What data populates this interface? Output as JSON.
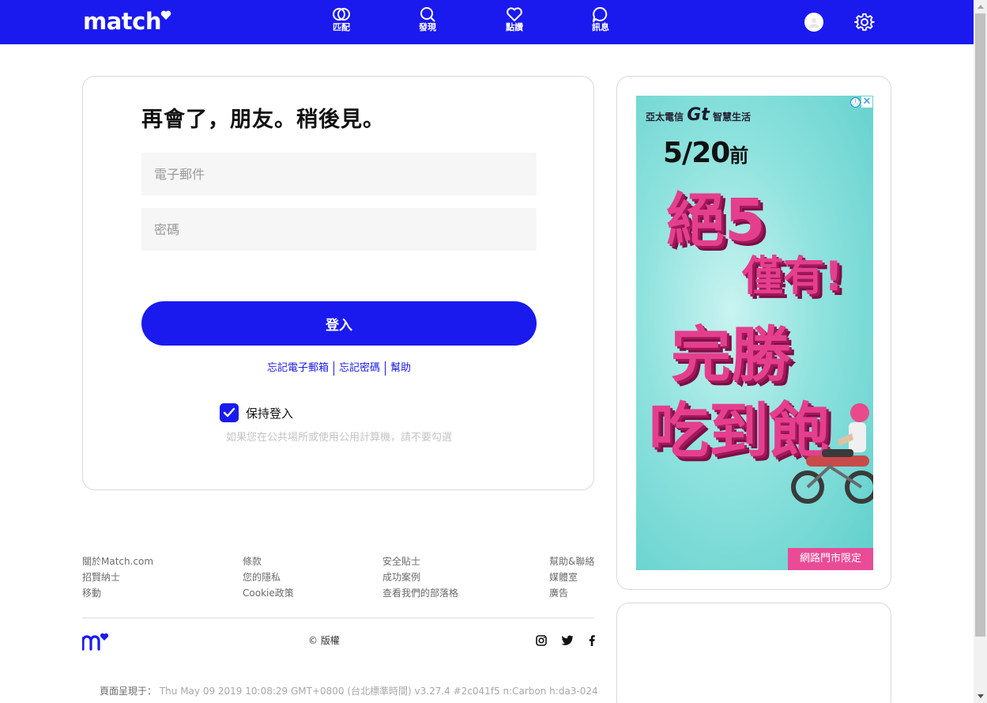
{
  "header": {
    "logo": "match",
    "nav": [
      {
        "label": "匹配",
        "icon": "match-rings-icon"
      },
      {
        "label": "發現",
        "icon": "search-icon"
      },
      {
        "label": "點讚",
        "icon": "heart-icon"
      },
      {
        "label": "訊息",
        "icon": "chat-bubble-icon"
      }
    ],
    "brand_color": "#1a1aef"
  },
  "login": {
    "title": "再會了，朋友。稍後見。",
    "email_placeholder": "電子郵件",
    "password_placeholder": "密碼",
    "submit_label": "登入",
    "links": [
      "忘記電子郵箱",
      "忘記密碼",
      "幫助"
    ],
    "remember_label": "保持登入",
    "remember_checked": true,
    "remember_note": "如果您在公共場所或使用公用計算機，請不要勾選"
  },
  "ad": {
    "brand": "亞太電信",
    "brand_mark": "Gt",
    "brand_tagline": "智慧生活",
    "date_text": "5/20",
    "date_suffix": "前",
    "line1": "絕5",
    "line2": "僅有!",
    "line3": "完勝",
    "line4": "吃到飽",
    "badge": "網路門市限定",
    "info_icon": "ⓘ",
    "close_icon": "✕"
  },
  "footer": {
    "columns": [
      [
        "關於Match.com",
        "招賢納士",
        "移動"
      ],
      [
        "條款",
        "您的隱私",
        "Cookie政策"
      ],
      [
        "安全貼士",
        "成功案例",
        "查看我們的部落格"
      ],
      [
        "幫助&聯絡",
        "媒體室",
        "廣告"
      ]
    ],
    "copyright": "© 版權",
    "build_label": "頁面呈現于：",
    "build_info": "Thu May 09 2019 10:08:29 GMT+0800 (台北標準時間) v3.27.4 #2c041f5 n:Carbon h:da3-024"
  }
}
